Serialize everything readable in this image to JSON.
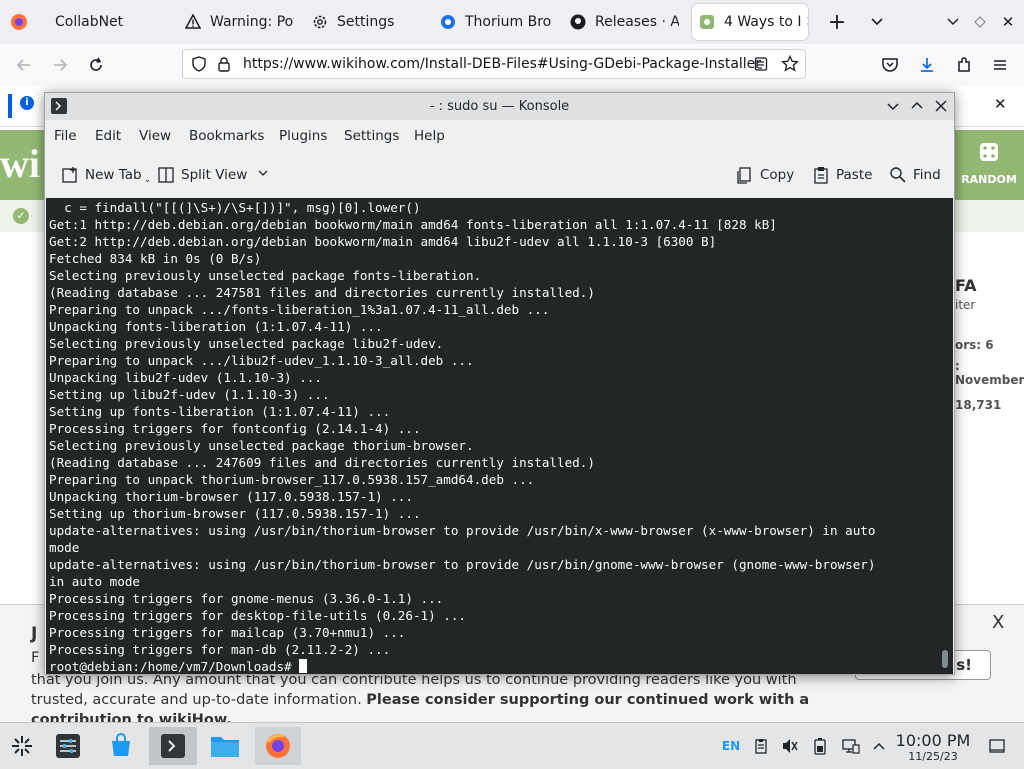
{
  "firefox": {
    "tabs": [
      {
        "label": "CollabNet"
      },
      {
        "label": "Warning: Pote"
      },
      {
        "label": "Settings"
      },
      {
        "label": "Thorium Brow"
      },
      {
        "label": "Releases · Ale"
      },
      {
        "label": "4 Ways to I"
      }
    ],
    "url": "https://www.wikihow.com/Install-DEB-Files#Using-GDebi-Package-Installer"
  },
  "webpage": {
    "logo": "wi",
    "random_label": "RANDOM",
    "side": {
      "l1": "FA",
      "l2": "iter",
      "l3": "ors: 6",
      "l4": ": November",
      "l5": "18,731"
    },
    "donate": {
      "heading_partial": "J",
      "line_fragment": "F",
      "text": "that you join us. Any amount that you can contribute helps us to continue providing readers like you with trusted, accurate and up-to-date information.",
      "bold_text": "Please consider supporting our continued work with a contribution to wikiHow.",
      "button_label": "is!",
      "close": "X"
    }
  },
  "konsole": {
    "title": "- : sudo su — Konsole",
    "menu": [
      "File",
      "Edit",
      "View",
      "Bookmarks",
      "Plugins",
      "Settings",
      "Help"
    ],
    "toolbar": {
      "new_tab": "New Tab",
      "split_view": "Split View",
      "copy": "Copy",
      "paste": "Paste",
      "find": "Find"
    },
    "lines": [
      "  c = findall(\"[[(]\\S+)/\\S+[])]\", msg)[0].lower()",
      "Get:1 http://deb.debian.org/debian bookworm/main amd64 fonts-liberation all 1:1.07.4-11 [828 kB]",
      "Get:2 http://deb.debian.org/debian bookworm/main amd64 libu2f-udev all 1.1.10-3 [6300 B]",
      "Fetched 834 kB in 0s (0 B/s)",
      "Selecting previously unselected package fonts-liberation.",
      "(Reading database ... 247581 files and directories currently installed.)",
      "Preparing to unpack .../fonts-liberation_1%3a1.07.4-11_all.deb ...",
      "Unpacking fonts-liberation (1:1.07.4-11) ...",
      "Selecting previously unselected package libu2f-udev.",
      "Preparing to unpack .../libu2f-udev_1.1.10-3_all.deb ...",
      "Unpacking libu2f-udev (1.1.10-3) ...",
      "Setting up libu2f-udev (1.1.10-3) ...",
      "Setting up fonts-liberation (1:1.07.4-11) ...",
      "Processing triggers for fontconfig (2.14.1-4) ...",
      "Selecting previously unselected package thorium-browser.",
      "(Reading database ... 247609 files and directories currently installed.)",
      "Preparing to unpack thorium-browser_117.0.5938.157_amd64.deb ...",
      "Unpacking thorium-browser (117.0.5938.157-1) ...",
      "Setting up thorium-browser (117.0.5938.157-1) ...",
      "update-alternatives: using /usr/bin/thorium-browser to provide /usr/bin/x-www-browser (x-www-browser) in auto",
      "mode",
      "update-alternatives: using /usr/bin/thorium-browser to provide /usr/bin/gnome-www-browser (gnome-www-browser)",
      "in auto mode",
      "Processing triggers for gnome-menus (3.36.0-1.1) ...",
      "Processing triggers for desktop-file-utils (0.26-1) ...",
      "Processing triggers for mailcap (3.70+nmu1) ...",
      "Processing triggers for man-db (2.11.2-2) ..."
    ],
    "prompt": "root@debian:/home/vm7/Downloads# "
  },
  "taskbar": {
    "lang": "EN",
    "time": "10:00 PM",
    "date": "11/25/23"
  }
}
